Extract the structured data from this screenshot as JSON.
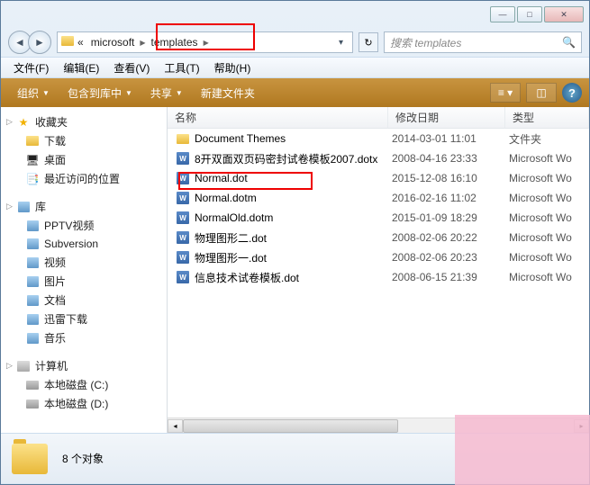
{
  "breadcrumb": {
    "seg1": "«",
    "seg2": "microsoft",
    "seg3": "templates"
  },
  "search": {
    "placeholder": "搜索 templates"
  },
  "menu": {
    "file": "文件(F)",
    "edit": "编辑(E)",
    "view": "查看(V)",
    "tools": "工具(T)",
    "help": "帮助(H)"
  },
  "toolbar": {
    "org": "组织",
    "include": "包含到库中",
    "share": "共享",
    "newfolder": "新建文件夹"
  },
  "columns": {
    "name": "名称",
    "date": "修改日期",
    "type": "类型"
  },
  "sidebar": {
    "fav": {
      "label": "收藏夹",
      "items": [
        "下载",
        "桌面",
        "最近访问的位置"
      ]
    },
    "lib": {
      "label": "库",
      "items": [
        "PPTV视频",
        "Subversion",
        "视频",
        "图片",
        "文档",
        "迅雷下载",
        "音乐"
      ]
    },
    "comp": {
      "label": "计算机",
      "items": [
        "本地磁盘 (C:)",
        "本地磁盘 (D:)"
      ]
    }
  },
  "files": [
    {
      "name": "Document Themes",
      "date": "2014-03-01 11:01",
      "type": "文件夹",
      "kind": "folder"
    },
    {
      "name": "8开双面双页码密封试卷模板2007.dotx",
      "date": "2008-04-16 23:33",
      "type": "Microsoft Wo",
      "kind": "word"
    },
    {
      "name": "Normal.dot",
      "date": "2015-12-08 16:10",
      "type": "Microsoft Wo",
      "kind": "word"
    },
    {
      "name": "Normal.dotm",
      "date": "2016-02-16 11:02",
      "type": "Microsoft Wo",
      "kind": "word"
    },
    {
      "name": "NormalOld.dotm",
      "date": "2015-01-09 18:29",
      "type": "Microsoft Wo",
      "kind": "word"
    },
    {
      "name": "物理图形二.dot",
      "date": "2008-02-06 20:22",
      "type": "Microsoft Wo",
      "kind": "word"
    },
    {
      "name": "物理图形一.dot",
      "date": "2008-02-06 20:23",
      "type": "Microsoft Wo",
      "kind": "word"
    },
    {
      "name": "信息技术试卷模板.dot",
      "date": "2008-06-15 21:39",
      "type": "Microsoft Wo",
      "kind": "word"
    }
  ],
  "status": {
    "count": "8 个对象"
  }
}
